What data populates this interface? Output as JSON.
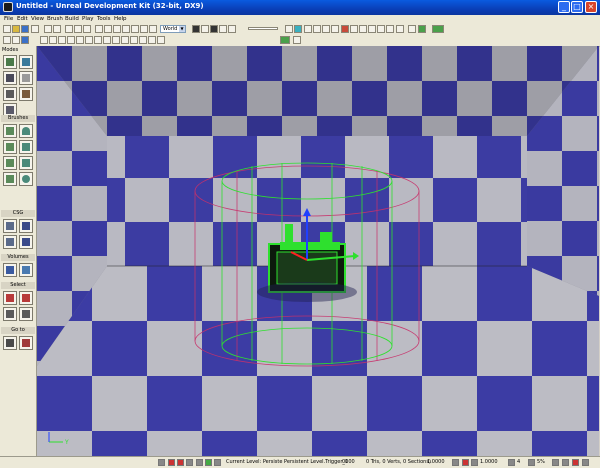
{
  "window": {
    "title": "Untitled - Unreal Development Kit (32-bit, DX9)"
  },
  "menubar": {
    "items": [
      "File",
      "Edit",
      "View",
      "Brush",
      "Build",
      "Play",
      "Tools",
      "Help"
    ]
  },
  "toolbar": {
    "coord_system": "World"
  },
  "left_panel": {
    "modes_label": "Modes",
    "sections": [
      "Brushes",
      "CSG",
      "Volumes",
      "Select",
      "Go to"
    ]
  },
  "viewport": {
    "axis_label": "Y"
  },
  "statusbar": {
    "current_level": "Current Level:  Persiste Persistent Level.Trigger_1",
    "value_a": "0000",
    "stats": "0 Tris, 0 Verts, 0 Sections)",
    "value_b": "1.0000",
    "value_c": "1.0000",
    "snap": "4",
    "percent": "5%"
  },
  "colors": {
    "checker_blue": "#3c3ca0",
    "checker_grey": "#b8b8c0",
    "trigger_green": "#2ee02e",
    "cylinder_red": "#c8306a"
  }
}
